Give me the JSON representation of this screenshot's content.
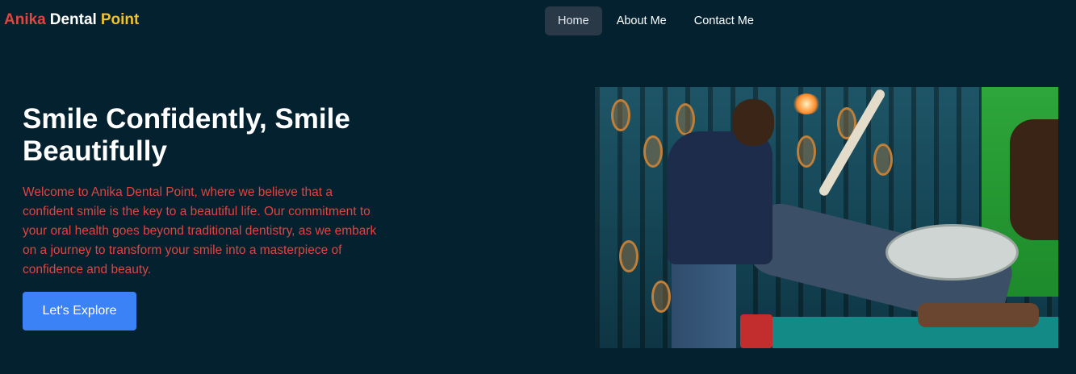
{
  "brand": {
    "word1": "Anika",
    "word2": "Dental",
    "word3": "Point",
    "colors": {
      "word1": "#e2443f",
      "word2": "#ffffff",
      "word3": "#f2c12e"
    }
  },
  "nav": {
    "items": [
      {
        "label": "Home",
        "active": true
      },
      {
        "label": "About Me",
        "active": false
      },
      {
        "label": "Contact Me",
        "active": false
      }
    ]
  },
  "hero": {
    "title": "Smile Confidently, Smile Beautifully",
    "description": "Welcome to Anika Dental Point, where we believe that a confident smile is the key to a beautiful life. Our commitment to your oral health goes beyond traditional dentistry, as we embark on a journey to transform your smile into a masterpiece of confidence and beauty.",
    "cta_label": "Let's Explore",
    "image_icon": "dental-clinic-photo"
  },
  "colors": {
    "background": "#03212f",
    "accent": "#3b82f6",
    "description_text": "#e2443f",
    "nav_active_bg": "#2a3948"
  }
}
